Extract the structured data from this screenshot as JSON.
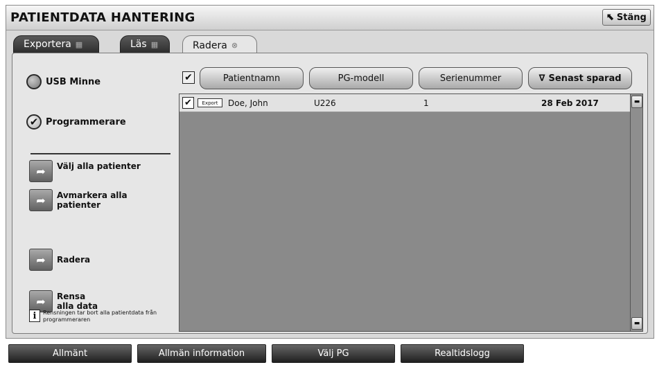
{
  "window": {
    "title": "PATIENTDATA HANTERING",
    "close_label": "Stäng",
    "close_icon": "cursor-arrow-icon"
  },
  "tabs": [
    {
      "label": "Exportera",
      "state": "inactive"
    },
    {
      "label": "Läs",
      "state": "inactive"
    },
    {
      "label": "Radera",
      "state": "active"
    }
  ],
  "source": {
    "options": [
      {
        "label": "USB Minne",
        "selected": false
      },
      {
        "label": "Programmerare",
        "selected": true
      }
    ]
  },
  "actions": {
    "select_all": "Välj alla patienter",
    "deselect_all": "Avmarkera alla patienter",
    "delete": "Radera",
    "clear_all": "Rensa alla data"
  },
  "info": {
    "text": "Rensningen tar bort alla patientdata från programmeraren"
  },
  "table": {
    "columns": [
      "Patientnamn",
      "PG-modell",
      "Serienummer",
      "Senast sparad"
    ],
    "sort_indicator": "∇",
    "rows": [
      {
        "checked": true,
        "badge": "Export",
        "name": "Doe, John",
        "model": "U226",
        "serial": "1",
        "last_saved": "28 Feb 2017"
      }
    ]
  },
  "bottom_nav": [
    "Allmänt",
    "Allmän information",
    "Välj PG",
    "Realtidslogg"
  ],
  "colors": {
    "window_bg": "#d9d9d9",
    "content_bg": "#e6e6e6",
    "list_bg": "#8a8a8a",
    "tab_dark": "#3a3a3a",
    "nav_dark": "#2a2a2a"
  }
}
